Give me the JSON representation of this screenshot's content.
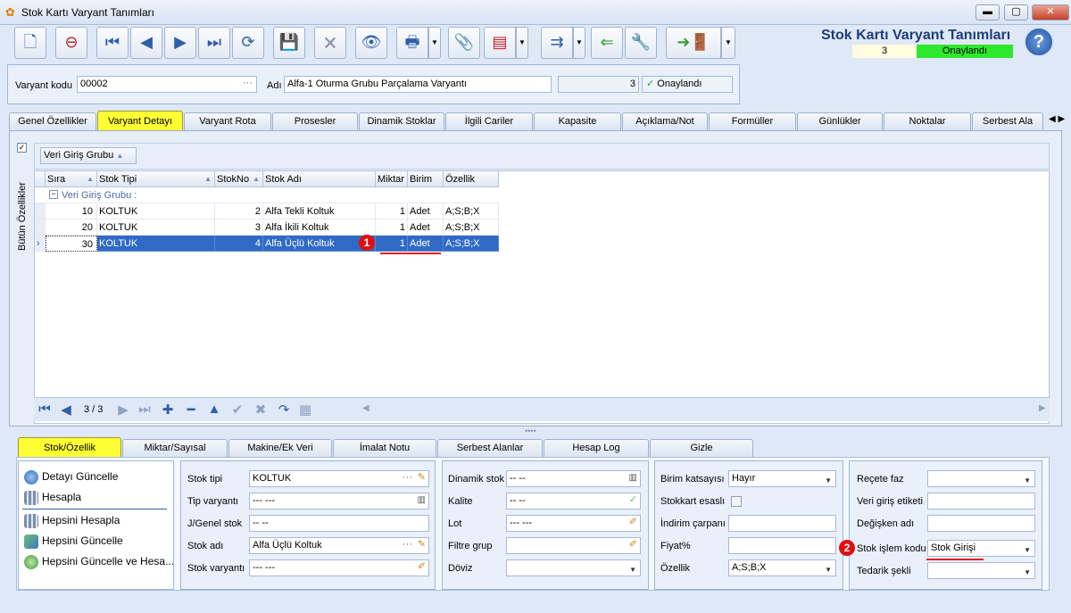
{
  "window": {
    "title": "Stok Kartı Varyant Tanımları"
  },
  "header": {
    "title": "Stok Kartı Varyant Tanımları",
    "count": "3",
    "status": "Onaylandı",
    "help_label": "?"
  },
  "form": {
    "variant_code_label": "Varyant kodu",
    "variant_code_value": "00002",
    "name_label": "Adı",
    "name_value": "Alfa-1 Oturma Grubu Parçalama Varyantı",
    "qty_value": "3",
    "approved_label": "Onaylandı",
    "ellipsis": "···"
  },
  "tabs": [
    "Genel Özellikler",
    "Varyant Detayı",
    "Varyant Rota",
    "Prosesler",
    "Dinamik Stoklar",
    "İlgili Cariler",
    "Kapasite",
    "Açıklama/Not",
    "Formüller",
    "Günlükler",
    "Noktalar",
    "Serbest Ala"
  ],
  "side": {
    "vertical_label": "Bütün Özellikler"
  },
  "group_box": {
    "label": "Veri Giriş Grubu"
  },
  "grid": {
    "columns": [
      "Sıra",
      "Stok Tipi",
      "StokNo",
      "Stok Adı",
      "Miktar",
      "Birim",
      "Özellik"
    ],
    "group_label": "Veri Giriş Grubu :",
    "rows": [
      {
        "sira": "10",
        "tip": "KOLTUK",
        "no": "2",
        "adi": "Alfa Tekli Koltuk",
        "miktar": "1",
        "birim": "Adet",
        "ozellik": "A;S;B;X"
      },
      {
        "sira": "20",
        "tip": "KOLTUK",
        "no": "3",
        "adi": "Alfa İkili Koltuk",
        "miktar": "1",
        "birim": "Adet",
        "ozellik": "A;S;B;X"
      },
      {
        "sira": "30",
        "tip": "KOLTUK",
        "no": "4",
        "adi": "Alfa Üçlü Koltuk",
        "miktar": "1",
        "birim": "Adet",
        "ozellik": "A;S;B;X"
      }
    ],
    "nav_page": "3 / 3"
  },
  "badges": {
    "one": "1",
    "two": "2"
  },
  "bottom_tabs": [
    "Stok/Özellik",
    "Miktar/Sayısal",
    "Makine/Ek Veri",
    "İmalat Notu",
    "Serbest Alanlar",
    "Hesap Log",
    "Gizle"
  ],
  "actions": [
    "Detayı Güncelle",
    "Hesapla",
    "Hepsini Hesapla",
    "Hepsini Güncelle",
    "Hepsini Güncelle ve Hesa..."
  ],
  "group1": {
    "labels": [
      "Stok tipi",
      "Tip varyantı",
      "J/Genel stok",
      "Stok adı",
      "Stok varyantı"
    ],
    "values": [
      "KOLTUK",
      "--- ---",
      "-- --",
      "Alfa Üçlü Koltuk",
      "--- ---"
    ]
  },
  "group2": {
    "labels": [
      "Dinamik stok",
      "Kalite",
      "Lot",
      "Filtre grup",
      "Döviz"
    ],
    "values": [
      "-- --",
      "-- --",
      "--- ---",
      "",
      ""
    ]
  },
  "group3": {
    "labels": [
      "Birim katsayısı",
      "Stokkart esaslı",
      "İndirim çarpanı",
      "Fiyat%",
      "Özellik"
    ],
    "values": [
      "Hayır",
      "",
      "",
      "",
      "A;S;B;X"
    ]
  },
  "group4": {
    "labels": [
      "Reçete faz",
      "Veri giriş etiketi",
      "Değişken adı",
      "Stok işlem kodu",
      "Tedarik şekli"
    ],
    "values": [
      "",
      "",
      "",
      "Stok Girişi",
      ""
    ]
  },
  "colors": {
    "accent_tab": "#ffff33",
    "selected_row": "#316ac5",
    "status_green": "#2ee82e",
    "badge_red": "#e01010"
  }
}
